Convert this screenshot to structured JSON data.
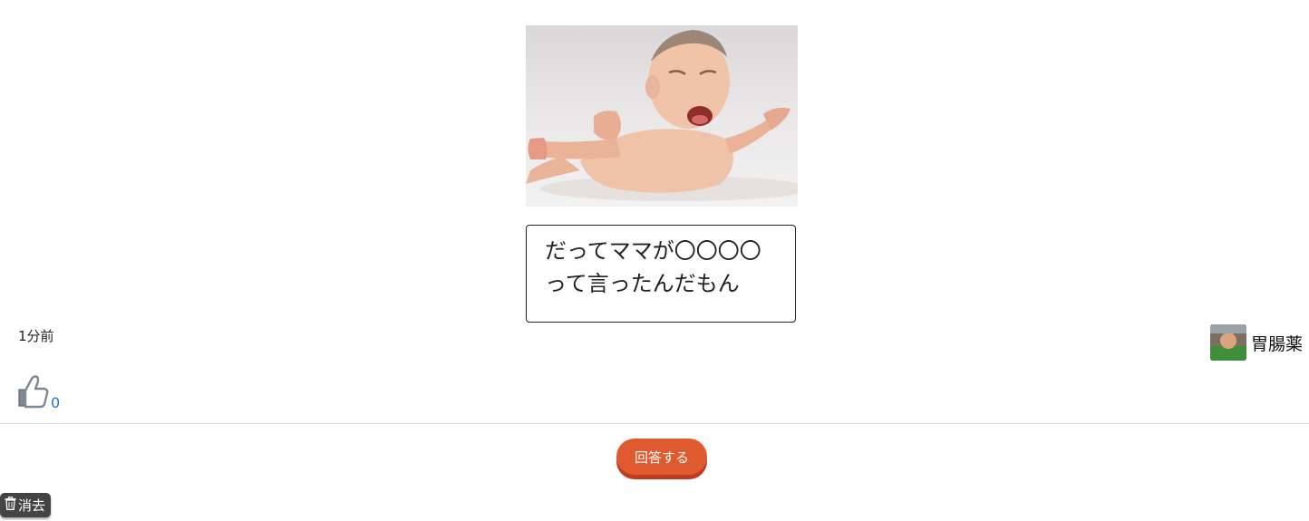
{
  "post": {
    "image_subject": "crying baby lying on stomach with arms spread",
    "answer_lines": [
      "だってママが〇〇〇〇",
      "って言ったんだもん"
    ],
    "timestamp": "1分前",
    "author_name": "胃腸薬",
    "like_count": "0"
  },
  "actions": {
    "answer_button_label": "回答する",
    "clear_button_label": "消去"
  },
  "icons": {
    "like": "thumbs-up-icon",
    "clear": "trash-icon",
    "avatar": "user-avatar"
  },
  "colors": {
    "answer_button": "#e05a2f",
    "like_count": "#1a73e8",
    "clear_button": "#444444"
  }
}
